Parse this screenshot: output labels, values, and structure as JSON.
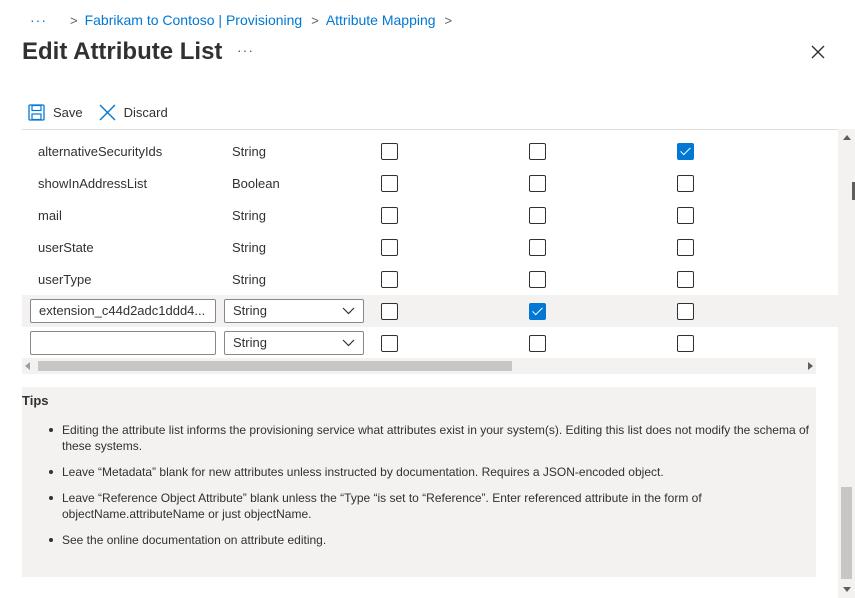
{
  "breadcrumb": {
    "more": "···",
    "items": [
      "Fabrikam to Contoso | Provisioning",
      "Attribute Mapping"
    ]
  },
  "page": {
    "title": "Edit Attribute List",
    "more": "···"
  },
  "toolbar": {
    "save_label": "Save",
    "discard_label": "Discard"
  },
  "rows": [
    {
      "name": "alternativeSecurityIds",
      "type": "String",
      "c1": false,
      "c2": false,
      "c3": true
    },
    {
      "name": "showInAddressList",
      "type": "Boolean",
      "c1": false,
      "c2": false,
      "c3": false
    },
    {
      "name": "mail",
      "type": "String",
      "c1": false,
      "c2": false,
      "c3": false
    },
    {
      "name": "userState",
      "type": "String",
      "c1": false,
      "c2": false,
      "c3": false
    },
    {
      "name": "userType",
      "type": "String",
      "c1": false,
      "c2": false,
      "c3": false
    }
  ],
  "edit_rows": [
    {
      "name_value": "extension_c44d2adc1ddd4...",
      "type_value": "String",
      "c1": false,
      "c2": true,
      "c3": false,
      "selected": true
    },
    {
      "name_value": "",
      "type_value": "String",
      "c1": false,
      "c2": false,
      "c3": false,
      "selected": false
    }
  ],
  "tips": {
    "heading": "Tips",
    "items": [
      "Editing the attribute list informs the provisioning service what attributes exist in your system(s). Editing this list does not modify the schema of these systems.",
      "Leave “Metadata” blank for new attributes unless instructed by documentation. Requires a JSON-encoded object.",
      "Leave “Reference Object Attribute” blank unless the “Type “is set to “Reference”. Enter referenced attribute in the form of objectName.attributeName or just objectName.",
      "See the online documentation on attribute editing."
    ]
  },
  "colors": {
    "accent": "#0078d4",
    "text": "#323130",
    "panel": "#f3f2f1"
  }
}
